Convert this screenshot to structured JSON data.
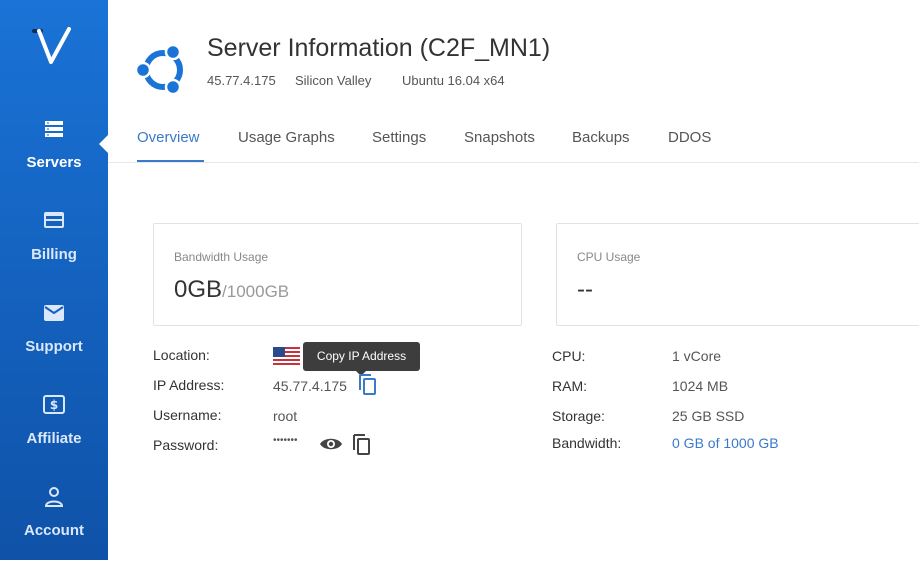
{
  "sidebar": {
    "items": [
      {
        "label": "Servers",
        "icon": "servers-icon",
        "active": true
      },
      {
        "label": "Billing",
        "icon": "credit-card-icon"
      },
      {
        "label": "Support",
        "icon": "envelope-icon"
      },
      {
        "label": "Affiliate",
        "icon": "dollar-icon"
      },
      {
        "label": "Account",
        "icon": "user-icon"
      }
    ]
  },
  "header": {
    "title": "Server Information (C2F_MN1)",
    "ip": "45.77.4.175",
    "location": "Silicon Valley",
    "os": "Ubuntu 16.04 x64",
    "os_icon": "ubuntu-logo-icon",
    "os_color": "#1a73d6"
  },
  "tabs": [
    {
      "label": "Overview",
      "active": true
    },
    {
      "label": "Usage Graphs"
    },
    {
      "label": "Settings"
    },
    {
      "label": "Snapshots"
    },
    {
      "label": "Backups"
    },
    {
      "label": "DDOS"
    }
  ],
  "cards": {
    "bandwidth": {
      "label": "Bandwidth Usage",
      "used": "0GB",
      "total": "/1000GB"
    },
    "cpu": {
      "label": "CPU Usage",
      "value": "--"
    }
  },
  "details_left": {
    "location_label": "Location:",
    "ip_label": "IP Address:",
    "ip_value": "45.77.4.175",
    "username_label": "Username:",
    "username_value": "root",
    "password_label": "Password:",
    "password_value": "•••••••",
    "tooltip": "Copy IP Address"
  },
  "details_right": {
    "cpu_label": "CPU:",
    "cpu_value": "1 vCore",
    "ram_label": "RAM:",
    "ram_value": "1024 MB",
    "storage_label": "Storage:",
    "storage_value": "25 GB SSD",
    "bandwidth_label": "Bandwidth:",
    "bandwidth_value": "0 GB of 1000 GB"
  },
  "colors": {
    "accent": "#3b79c9",
    "sidebar": "#1462bf"
  }
}
